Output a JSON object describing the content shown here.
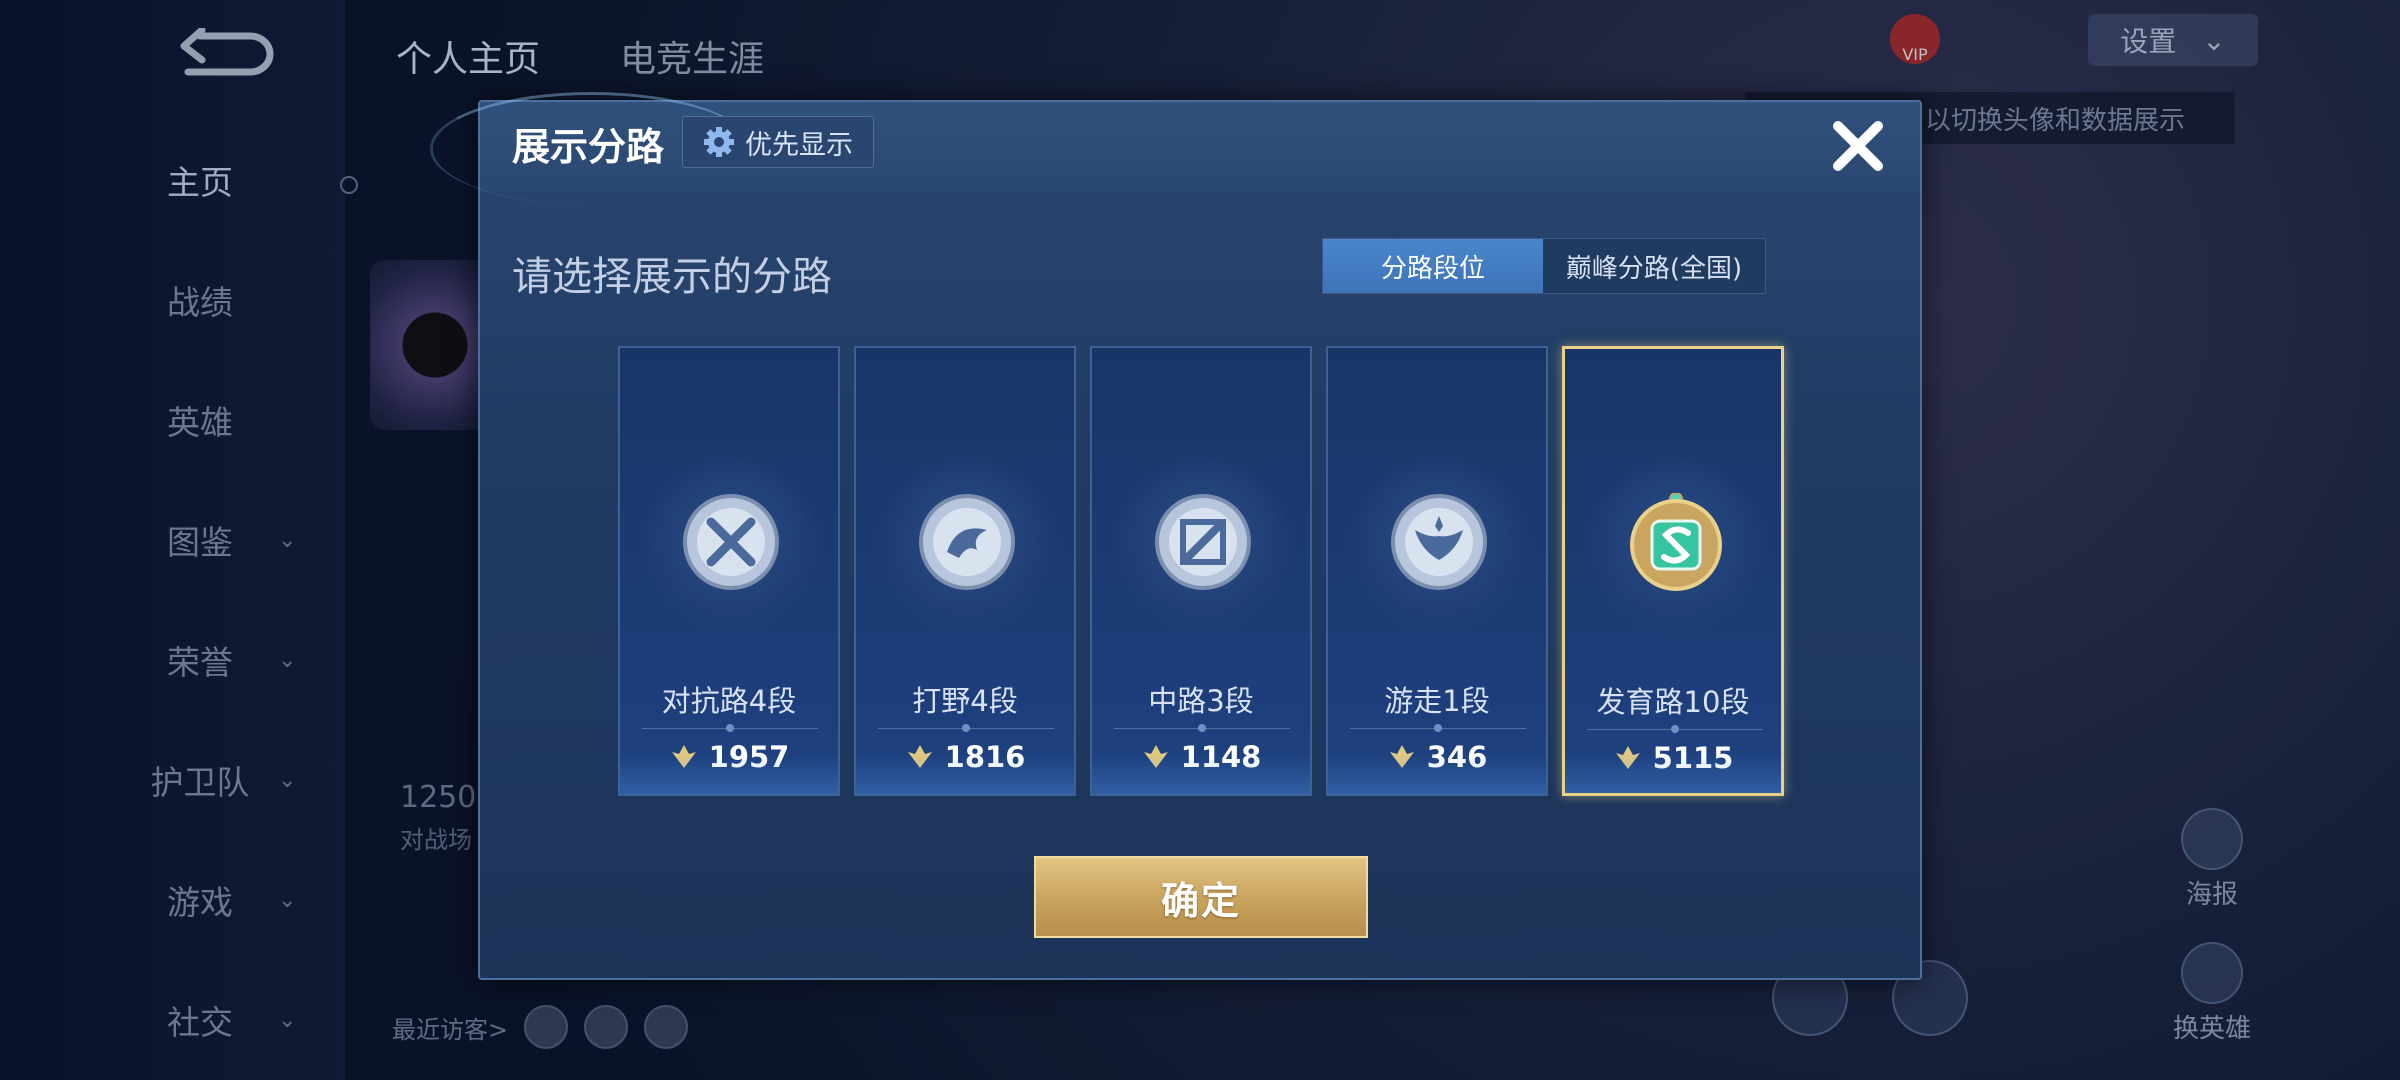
{
  "nav": {
    "items": [
      {
        "label": "主页",
        "has_chevron": false,
        "active": true
      },
      {
        "label": "战绩",
        "has_chevron": false
      },
      {
        "label": "英雄",
        "has_chevron": false
      },
      {
        "label": "图鉴",
        "has_chevron": true
      },
      {
        "label": "荣誉",
        "has_chevron": true
      },
      {
        "label": "护卫队",
        "has_chevron": true
      },
      {
        "label": "游戏",
        "has_chevron": true
      },
      {
        "label": "社交",
        "has_chevron": true
      }
    ]
  },
  "top_tabs": [
    {
      "label": "个人主页",
      "active": true
    },
    {
      "label": "电竞生涯"
    }
  ],
  "background": {
    "profile_stat": "1250",
    "profile_stat_label": "对战场",
    "recent_visitors_label": "最近访客>",
    "hint_text": "以切换头像和数据展示",
    "vip_label": "VIP",
    "settings_label": "设置",
    "side_buttons": [
      {
        "label": "海报",
        "icon": "poster-icon"
      },
      {
        "label": "换英雄",
        "icon": "swap-hero-icon"
      }
    ]
  },
  "modal": {
    "title": "展示分路",
    "priority_label": "优先显示",
    "subtitle": "请选择展示的分路",
    "segment": [
      {
        "label": "分路段位",
        "active": true
      },
      {
        "label": "巅峰分路(全国)",
        "active": false
      }
    ],
    "cards": [
      {
        "rank": "对抗路4段",
        "points": "1957",
        "icon": "clash-lane-emblem-icon",
        "selected": false
      },
      {
        "rank": "打野4段",
        "points": "1816",
        "icon": "jungle-emblem-icon",
        "selected": false
      },
      {
        "rank": "中路3段",
        "points": "1148",
        "icon": "mid-lane-emblem-icon",
        "selected": false
      },
      {
        "rank": "游走1段",
        "points": "346",
        "icon": "roam-emblem-icon",
        "selected": false
      },
      {
        "rank": "发育路10段",
        "points": "5115",
        "icon": "farm-lane-emblem-icon",
        "selected": true
      }
    ],
    "confirm_label": "确定"
  },
  "colors": {
    "modal_bg": "#213b63",
    "accent_blue": "#4a86cc",
    "selected_gold": "#e9d18a",
    "confirm_gold": "#c9a560"
  }
}
